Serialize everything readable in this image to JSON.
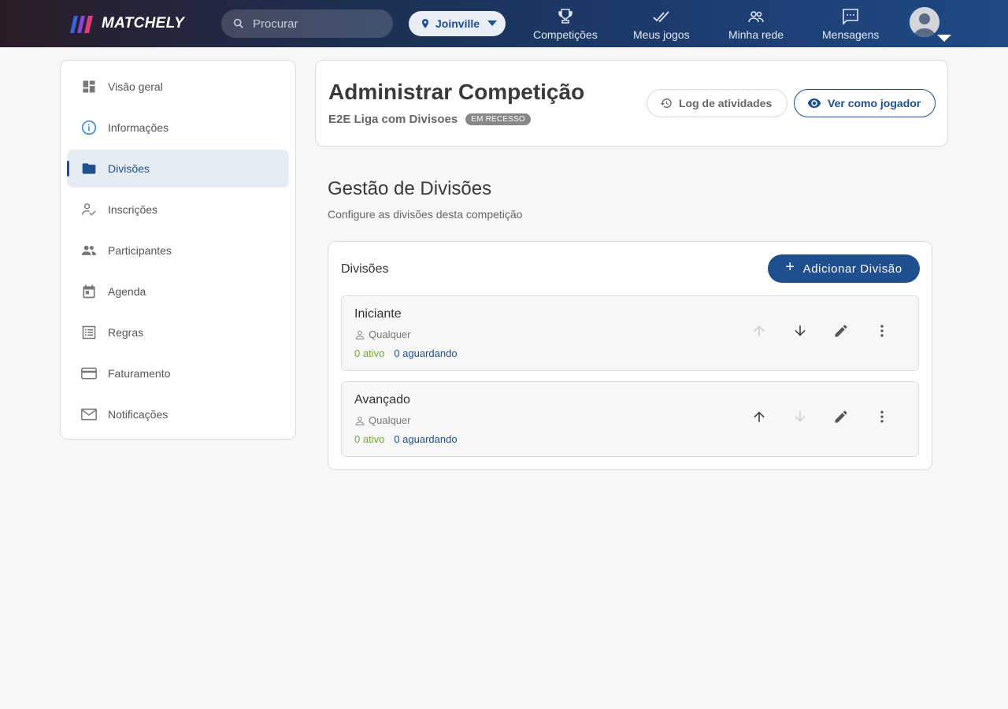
{
  "header": {
    "brand": "MATCHELY",
    "search_placeholder": "Procurar",
    "city": "Joinville",
    "nav": [
      {
        "label": "Competições",
        "icon": "trophy-icon"
      },
      {
        "label": "Meus jogos",
        "icon": "double-check-icon"
      },
      {
        "label": "Minha rede",
        "icon": "people-icon"
      },
      {
        "label": "Mensagens",
        "icon": "message-icon"
      }
    ]
  },
  "sidebar": {
    "items": [
      {
        "label": "Visão geral",
        "icon": "dashboard-icon"
      },
      {
        "label": "Informações",
        "icon": "info-icon"
      },
      {
        "label": "Divisões",
        "icon": "folder-icon",
        "active": true
      },
      {
        "label": "Inscrições",
        "icon": "person-check-icon"
      },
      {
        "label": "Participantes",
        "icon": "people-icon"
      },
      {
        "label": "Agenda",
        "icon": "calendar-icon"
      },
      {
        "label": "Regras",
        "icon": "list-icon"
      },
      {
        "label": "Faturamento",
        "icon": "credit-card-icon"
      },
      {
        "label": "Notificações",
        "icon": "mail-icon"
      }
    ]
  },
  "page": {
    "title": "Administrar Competição",
    "competition_name": "E2E Liga com Divisoes",
    "status_badge": "EM RECESSO",
    "log_button": "Log de atividades",
    "view_button": "Ver como jogador"
  },
  "section": {
    "title": "Gestão de Divisões",
    "subtitle": "Configure as divisões desta competição",
    "card_title": "Divisões",
    "add_button": "Adicionar Divisão"
  },
  "divisions": [
    {
      "name": "Iniciante",
      "category": "Qualquer",
      "active": "0 ativo",
      "waiting": "0 aguardando",
      "up_enabled": false,
      "down_enabled": true
    },
    {
      "name": "Avançado",
      "category": "Qualquer",
      "active": "0 ativo",
      "waiting": "0 aguardando",
      "up_enabled": true,
      "down_enabled": false
    }
  ],
  "colors": {
    "brand": "#1f4f8f",
    "active_green": "#74a830",
    "disabled_icon": "#c8c8c8"
  }
}
